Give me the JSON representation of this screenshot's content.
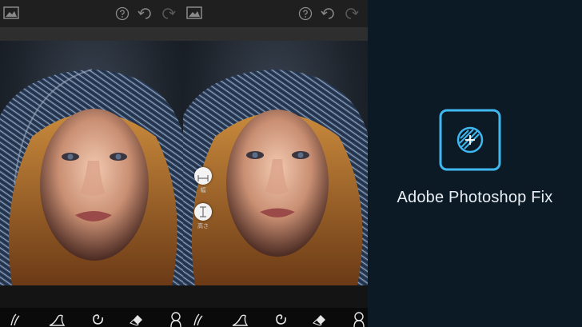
{
  "splash": {
    "app_name": "Adobe Photoshop Fix",
    "logo_icon": "photoshop-fix-logo-icon",
    "accent_color": "#3fb8f0",
    "background_color": "#0c1a26"
  },
  "editor_before": {
    "top_icons": [
      "image-icon",
      "help-icon",
      "undo-icon",
      "redo-icon"
    ],
    "tools": [
      "liquify-push-icon",
      "bloat-icon",
      "twirl-icon",
      "eraser-icon"
    ]
  },
  "editor_after": {
    "top_icons": [
      "image-icon",
      "help-icon",
      "undo-icon",
      "redo-icon"
    ],
    "side_tools": [
      {
        "icon": "width-arrows-icon",
        "label": "幅"
      },
      {
        "icon": "height-arrows-icon",
        "label": "高さ"
      }
    ],
    "tools": [
      "liquify-push-icon",
      "bloat-icon",
      "twirl-icon",
      "eraser-icon",
      "face-icon"
    ]
  }
}
